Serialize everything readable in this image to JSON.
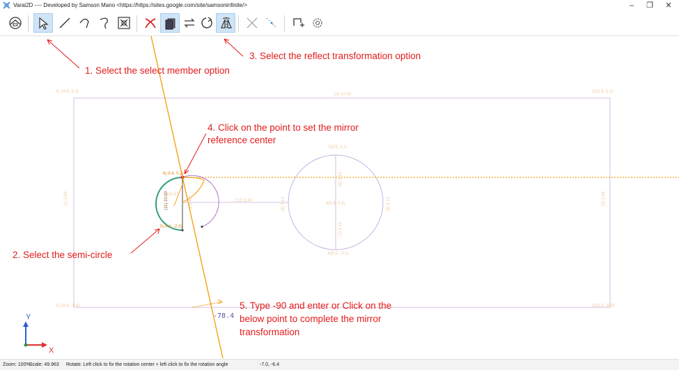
{
  "window": {
    "title": "Varai2D ---- Developed by Samson Mano <https://https://sites.google.com/site/samsoninfinite/>",
    "controls": {
      "minimize": "–",
      "maximize": "❐",
      "close": "✕"
    }
  },
  "toolbar": {
    "buttons": [
      {
        "name": "fit-view-icon",
        "active": false
      },
      {
        "name": "select-member-icon",
        "active": true
      },
      {
        "name": "line-icon",
        "active": false
      },
      {
        "name": "arc-icon",
        "active": false
      },
      {
        "name": "ellipse-arc-icon",
        "active": false
      },
      {
        "name": "zoom-extents-icon",
        "active": false
      },
      {
        "name": "delete-icon",
        "active": false
      },
      {
        "name": "copy-icon",
        "active": true
      },
      {
        "name": "translate-icon",
        "active": false
      },
      {
        "name": "rotate-icon",
        "active": false
      },
      {
        "name": "reflect-icon",
        "active": true
      },
      {
        "name": "intersect-icon",
        "active": false
      },
      {
        "name": "dashed-line-icon",
        "active": false
      },
      {
        "name": "add-surface-icon",
        "active": false
      },
      {
        "name": "settings-icon",
        "active": false
      }
    ]
  },
  "canvas": {
    "accent": "#f5a11a",
    "boundary_color": "#d4bfe3",
    "circle_color": "#c6b2dd",
    "rect_corner_labels": {
      "top_left": "4(-14.6, 5.1)",
      "top_right": "2(11.5, 5.1)",
      "bottom_left": "1(-14.6, -6.6)",
      "bottom_right": "3(11.5, -6.6)"
    },
    "rect_edge_labels": {
      "top": "(3) 10.00",
      "left": "(1) 3.08",
      "right": "(2) 3.08",
      "bottom": ""
    },
    "circle_labels": {
      "top": "7(5.5, 2.1)",
      "center": "8(5.5, 0.0)",
      "bottom": "6(5.5, -3.1)",
      "left_vert": "(4) 3.10",
      "right_vert": "(5) 3.10",
      "inner_vert_top": "(6) 3.10",
      "inner_vert_bottom": "(7) 3.10"
    },
    "semicircle_labels": {
      "top": "6(-8.6, 0.2)",
      "bottom": "5(-8.4, -2.3)",
      "inner": "(11) 10.00",
      "inner_small": "(10) 4.2",
      "mid": "(4) 4.1"
    },
    "horizontal_line_label": "(12) 3.64",
    "angle_readout": "-78.4",
    "axis": {
      "y": "Y",
      "x": "X"
    }
  },
  "annotations": [
    {
      "text": "1. Select the select member option"
    },
    {
      "text": "2. Select the semi-circle"
    },
    {
      "text": "3. Select the reflect transformation option"
    },
    {
      "text": "4. Click on the point to set the mirror"
    },
    {
      "text": "reference center"
    },
    {
      "text": "5. Type -90 and enter or Click on the"
    },
    {
      "text": "below point to complete the mirror"
    },
    {
      "text": "transformation"
    }
  ],
  "status": {
    "zoom": "Zoom: 100%",
    "scale": "Scale: 49.963",
    "message": "Rotate: Left click to fix the rotation center + left click to fix the rotation angle",
    "coords": "-7.0, -6.4"
  }
}
